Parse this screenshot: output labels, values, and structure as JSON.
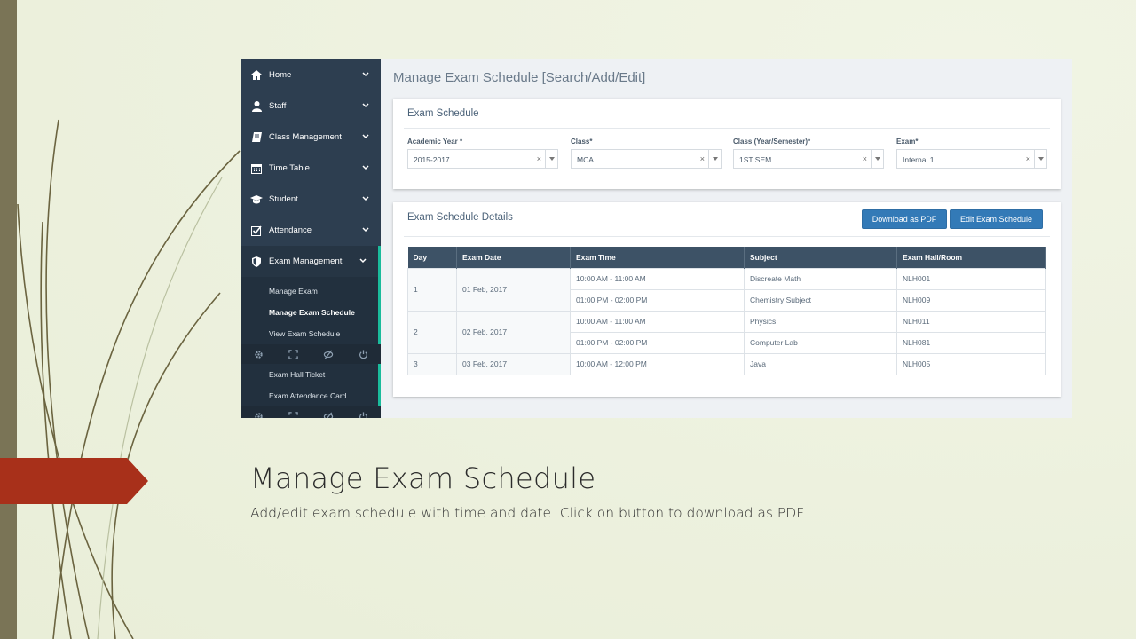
{
  "colors": {
    "sidebar": "#2d3e50",
    "accent": "#1abc9c",
    "button": "#337ab7",
    "tag": "#a8301a",
    "header_row": "#3d5266"
  },
  "sidebar": {
    "items": [
      {
        "label": "Home",
        "icon": "home-icon"
      },
      {
        "label": "Staff",
        "icon": "user-icon"
      },
      {
        "label": "Class Management",
        "icon": "book-icon"
      },
      {
        "label": "Time Table",
        "icon": "calendar-icon"
      },
      {
        "label": "Student",
        "icon": "graduation-cap-icon"
      },
      {
        "label": "Attendance",
        "icon": "checkbox-icon"
      },
      {
        "label": "Exam Management",
        "icon": "shield-icon"
      }
    ],
    "submenu": [
      "Manage Exam",
      "Manage Exam Schedule",
      "View Exam Schedule"
    ],
    "submenu2": [
      "Exam Hall Ticket",
      "Exam Attendance Card"
    ],
    "footer_icons": [
      "gear-icon",
      "expand-icon",
      "eye-slash-icon",
      "power-icon"
    ]
  },
  "main": {
    "page_title": "Manage Exam Schedule [Search/Add/Edit]",
    "filters": {
      "panel_title": "Exam Schedule",
      "fields": [
        {
          "label": "Academic Year *",
          "value": "2015-2017"
        },
        {
          "label": "Class*",
          "value": "MCA"
        },
        {
          "label": "Class (Year/Semester)*",
          "value": "1ST SEM"
        },
        {
          "label": "Exam*",
          "value": "Internal 1"
        }
      ],
      "clear_symbol": "×"
    },
    "details": {
      "panel_title": "Exam Schedule Details",
      "download_button": "Download as PDF",
      "edit_button": "Edit Exam Schedule",
      "columns": [
        "Day",
        "Exam Date",
        "Exam Time",
        "Subject",
        "Exam Hall/Room"
      ],
      "groups": [
        {
          "day": "1",
          "date": "01 Feb, 2017",
          "rows": [
            {
              "time": "10:00 AM - 11:00 AM",
              "subject": "Discreate Math",
              "hall": "NLH001"
            },
            {
              "time": "01:00 PM - 02:00 PM",
              "subject": "Chemistry Subject",
              "hall": "NLH009"
            }
          ]
        },
        {
          "day": "2",
          "date": "02 Feb, 2017",
          "rows": [
            {
              "time": "10:00 AM - 11:00 AM",
              "subject": "Physics",
              "hall": "NLH011"
            },
            {
              "time": "01:00 PM - 02:00 PM",
              "subject": "Computer Lab",
              "hall": "NLH081"
            }
          ]
        },
        {
          "day": "3",
          "date": "03 Feb, 2017",
          "rows": [
            {
              "time": "10:00 AM - 12:00 PM",
              "subject": "Java",
              "hall": "NLH005"
            }
          ]
        }
      ]
    }
  },
  "slide": {
    "title": "Manage Exam Schedule",
    "subtitle": "Add/edit exam schedule with time and date. Click on button to download as PDF"
  }
}
